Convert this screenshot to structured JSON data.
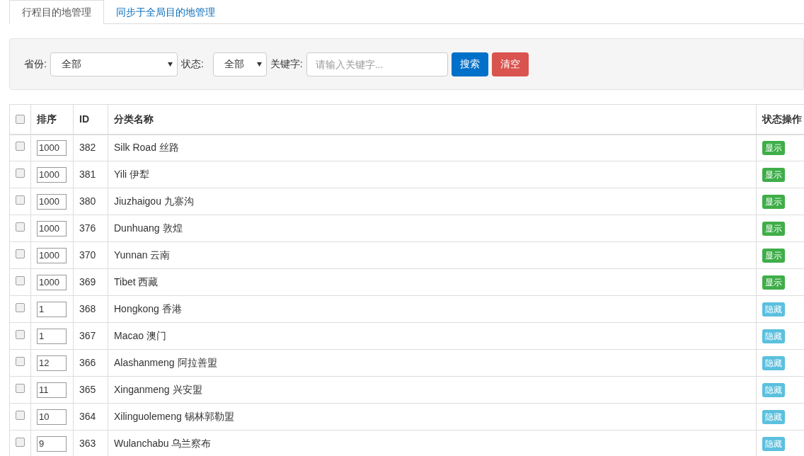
{
  "tabs": [
    {
      "label": "行程目的地管理",
      "selected": true
    },
    {
      "label": "同步于全局目的地管理",
      "selected": false
    }
  ],
  "filters": {
    "province_label": "省份:",
    "province_value": "全部",
    "status_label": "状态:",
    "status_value": "全部",
    "keyword_label": "关键字:",
    "keyword_placeholder": "请输入关键字...",
    "search_button": "搜索",
    "clear_button": "清空"
  },
  "table": {
    "select_all_checked": false,
    "columns": [
      "排序",
      "ID",
      "分类名称",
      "状态操作"
    ],
    "rows": [
      {
        "checked": false,
        "sort": "1000",
        "id": "382",
        "name": "Silk Road 丝路",
        "status": "显示",
        "kind": "shown"
      },
      {
        "checked": false,
        "sort": "1000",
        "id": "381",
        "name": "Yili 伊犁",
        "status": "显示",
        "kind": "shown"
      },
      {
        "checked": false,
        "sort": "1000",
        "id": "380",
        "name": "Jiuzhaigou 九寨沟",
        "status": "显示",
        "kind": "shown"
      },
      {
        "checked": false,
        "sort": "1000",
        "id": "376",
        "name": "Dunhuang 敦煌",
        "status": "显示",
        "kind": "shown"
      },
      {
        "checked": false,
        "sort": "1000",
        "id": "370",
        "name": "Yunnan 云南",
        "status": "显示",
        "kind": "shown"
      },
      {
        "checked": false,
        "sort": "1000",
        "id": "369",
        "name": "Tibet 西藏",
        "status": "显示",
        "kind": "shown"
      },
      {
        "checked": false,
        "sort": "1",
        "id": "368",
        "name": "Hongkong 香港",
        "status": "隐藏",
        "kind": "hidden"
      },
      {
        "checked": false,
        "sort": "1",
        "id": "367",
        "name": "Macao 澳门",
        "status": "隐藏",
        "kind": "hidden"
      },
      {
        "checked": false,
        "sort": "12",
        "id": "366",
        "name": "Alashanmeng 阿拉善盟",
        "status": "隐藏",
        "kind": "hidden"
      },
      {
        "checked": false,
        "sort": "11",
        "id": "365",
        "name": "Xinganmeng 兴安盟",
        "status": "隐藏",
        "kind": "hidden"
      },
      {
        "checked": false,
        "sort": "10",
        "id": "364",
        "name": "Xilinguolemeng 锡林郭勒盟",
        "status": "隐藏",
        "kind": "hidden"
      },
      {
        "checked": false,
        "sort": "9",
        "id": "363",
        "name": "Wulanchabu 乌兰察布",
        "status": "隐藏",
        "kind": "hidden"
      }
    ]
  }
}
